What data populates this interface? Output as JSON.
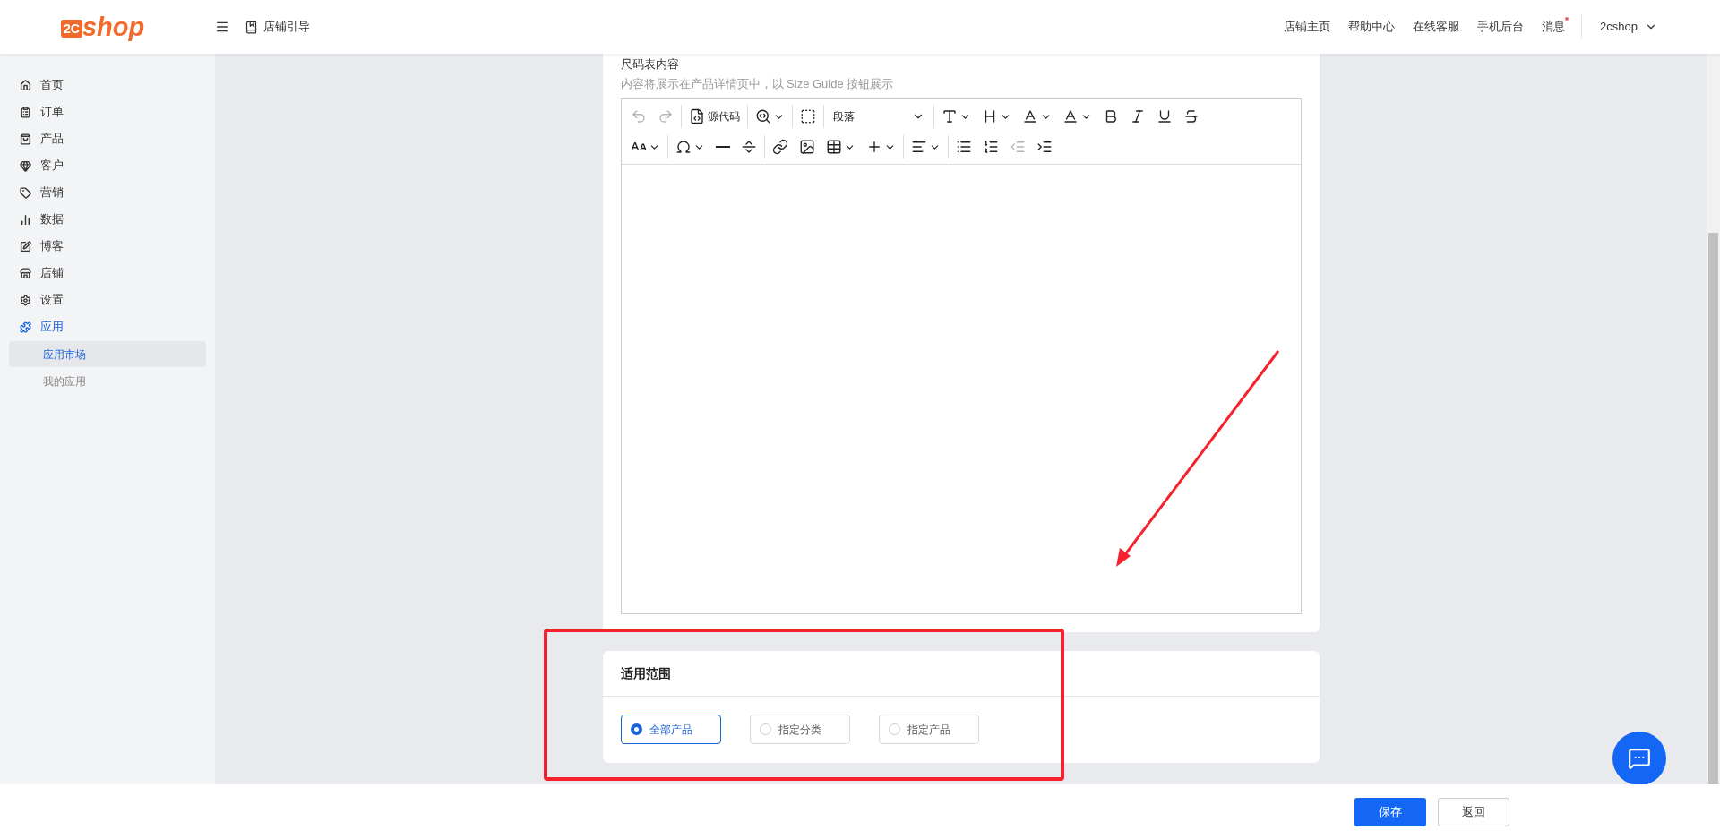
{
  "header": {
    "logo": {
      "mark": "2C",
      "text": "shop"
    },
    "guide": "店铺引导",
    "links": [
      "店铺主页",
      "帮助中心",
      "在线客服",
      "手机后台"
    ],
    "messages": {
      "label": "消息",
      "unread": true
    },
    "user": "2cshop"
  },
  "sidebar": {
    "items": [
      {
        "label": "首页",
        "selected": false
      },
      {
        "label": "订单",
        "selected": false
      },
      {
        "label": "产品",
        "selected": false
      },
      {
        "label": "客户",
        "selected": false
      },
      {
        "label": "营销",
        "selected": false
      },
      {
        "label": "数据",
        "selected": false
      },
      {
        "label": "博客",
        "selected": false
      },
      {
        "label": "店铺",
        "selected": false
      },
      {
        "label": "设置",
        "selected": false
      },
      {
        "label": "应用",
        "selected": true,
        "expanded": true,
        "children": [
          {
            "label": "应用市场",
            "selected": true
          },
          {
            "label": "我的应用",
            "selected": false
          }
        ]
      }
    ]
  },
  "editor": {
    "label": "尺码表内容",
    "hint": "内容将展示在产品详情页中，以 Size Guide 按钮展示",
    "toolbar": {
      "undo_disabled": true,
      "redo_disabled": true,
      "source_code": "源代码",
      "block_format": "段落",
      "outdent_disabled": true
    }
  },
  "scope": {
    "title": "适用范围",
    "options": [
      {
        "label": "全部产品",
        "selected": true
      },
      {
        "label": "指定分类",
        "selected": false
      },
      {
        "label": "指定产品",
        "selected": false
      }
    ]
  },
  "footer": {
    "buttons": [
      "保存",
      "返回"
    ]
  }
}
